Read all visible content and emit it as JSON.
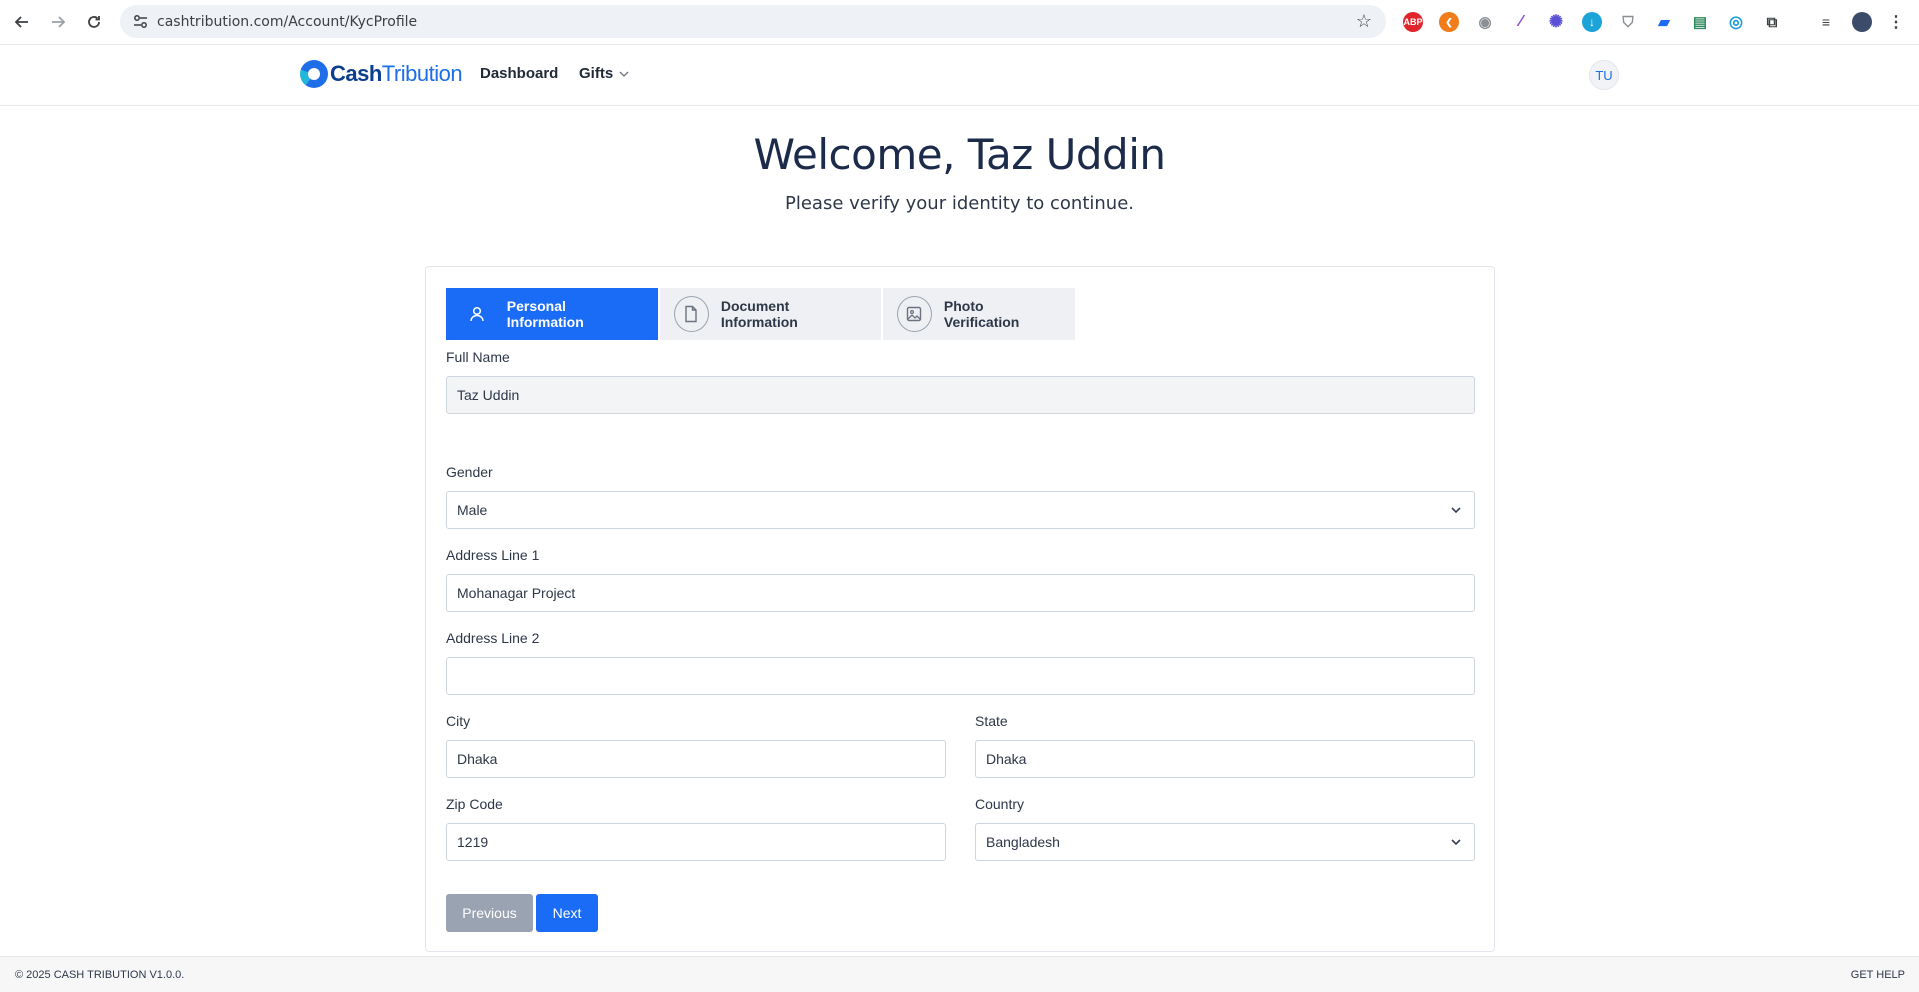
{
  "browser": {
    "url": "cashtribution.com/Account/KycProfile",
    "extensions": [
      {
        "name": "adblock-icon",
        "label": "ABP",
        "color": "#e0242b"
      },
      {
        "name": "orange-extension-icon",
        "label": "",
        "color": "#f07c1b"
      },
      {
        "name": "camera-extension-icon",
        "label": "",
        "color": "#8a8f96"
      },
      {
        "name": "pen-extension-icon",
        "label": "",
        "color": "#8e44c8"
      },
      {
        "name": "gear-star-extension-icon",
        "label": "",
        "color": "#5b4fd6"
      },
      {
        "name": "download-extension-icon",
        "label": "",
        "color": "#1ca3d8"
      },
      {
        "name": "shield-extension-icon",
        "label": "",
        "color": "#8a8f96"
      },
      {
        "name": "file-extension-icon",
        "label": "",
        "color": "#1a6cf6"
      },
      {
        "name": "drive-extension-icon",
        "label": "",
        "color": "#2f8a5e"
      },
      {
        "name": "target-extension-icon",
        "label": "",
        "color": "#1a9bd6"
      }
    ]
  },
  "app": {
    "logo_cash": "Cash",
    "logo_tribution": "Tribution",
    "nav": {
      "dashboard": "Dashboard",
      "gifts": "Gifts"
    },
    "avatar_initials": "TU"
  },
  "welcome": {
    "title": "Welcome, Taz Uddin",
    "subtitle": "Please verify your identity to continue."
  },
  "tabs": [
    {
      "label": "Personal Information",
      "icon": "user-icon",
      "active": true
    },
    {
      "label": "Document Information",
      "icon": "document-icon",
      "active": false
    },
    {
      "label": "Photo Verification",
      "icon": "image-icon",
      "active": false
    }
  ],
  "form": {
    "full_name": {
      "label": "Full Name",
      "value": "Taz Uddin"
    },
    "gender": {
      "label": "Gender",
      "value": "Male"
    },
    "address1": {
      "label": "Address Line 1",
      "value": "Mohanagar Project"
    },
    "address2": {
      "label": "Address Line 2",
      "value": ""
    },
    "city": {
      "label": "City",
      "value": "Dhaka"
    },
    "state": {
      "label": "State",
      "value": "Dhaka"
    },
    "zip": {
      "label": "Zip Code",
      "value": "1219"
    },
    "country": {
      "label": "Country",
      "value": "Bangladesh"
    },
    "previous_label": "Previous",
    "next_label": "Next"
  },
  "footer": {
    "copyright": "© 2025 CASH TRIBUTION V1.0.0.",
    "help": "GET HELP"
  }
}
